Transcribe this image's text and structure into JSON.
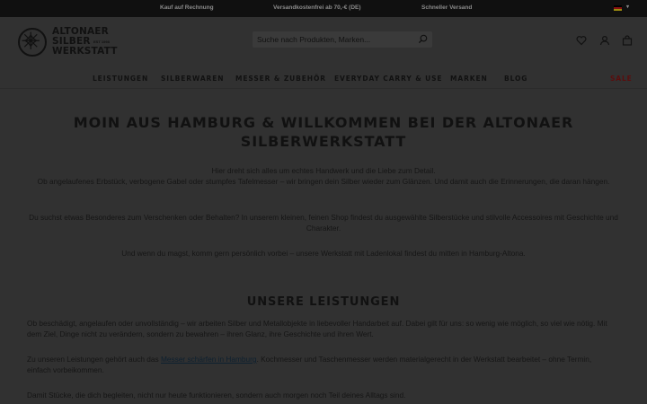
{
  "topbar": {
    "usps": [
      "Kauf auf Rechnung",
      "Versandkostenfrei ab 70,-€ (DE)",
      "Schneller Versand"
    ],
    "language_icon": "flag-de-icon"
  },
  "header": {
    "logo_lines": [
      "ALTONAER",
      "SILBER",
      "WERKSTATT"
    ],
    "logo_est": "EST 1998",
    "search_placeholder": "Suche nach Produkten, Marken...",
    "icons": [
      "heart-icon",
      "user-icon",
      "cart-icon"
    ]
  },
  "nav": {
    "items": [
      "LEISTUNGEN",
      "SILBERWAREN",
      "MESSER & ZUBEHÖR",
      "EVERYDAY CARRY & USE",
      "MARKEN",
      "BLOG"
    ],
    "sale": "SALE"
  },
  "main": {
    "title": "MOIN AUS HAMBURG & WILLKOMMEN BEI DER ALTONAER SILBERWERKSTATT",
    "intro_1": "Hier dreht sich alles um echtes Handwerk und die Liebe zum Detail.",
    "intro_2": "Ob angelaufenes Erbstück, verbogene Gabel oder stumpfes Tafelmesser – wir bringen dein Silber wieder zum Glänzen. Und damit auch die Erinnerungen, die daran hängen.",
    "intro_3": "Du suchst etwas Besonderes zum Verschenken oder Behalten? In unserem kleinen, feinen Shop findest du ausgewählte Silberstücke und stilvolle Accessoires mit Geschichte und Charakter.",
    "intro_4": "Und wenn du magst, komm gern persönlich vorbei – unsere Werkstatt mit Ladenlokal findest du mitten in Hamburg-Altona.",
    "services_title": "UNSERE LEISTUNGEN",
    "services_1": "Ob beschädigt, angelaufen oder unvollständig – wir arbeiten Silber und Metallobjekte in liebevoller Handarbeit auf. Dabei gilt für uns: so wenig wie möglich, so viel wie nötig. Mit dem Ziel, Dinge nicht zu verändern, sondern zu bewahren – ihren Glanz, ihre Geschichte und ihren Wert.",
    "services_2_pre": "Zu unseren Leistungen gehört auch das ",
    "services_2_link": "Messer schärfen in Hamburg",
    "services_2_post": ". Kochmesser und Taschenmesser werden materialgerecht in der Werkstatt bearbeitet – ohne Termin, einfach vorbeikommen.",
    "services_3": "Damit Stücke, die dich begleiten, nicht nur heute funktionieren, sondern auch morgen noch Teil deines Alltags sind."
  }
}
